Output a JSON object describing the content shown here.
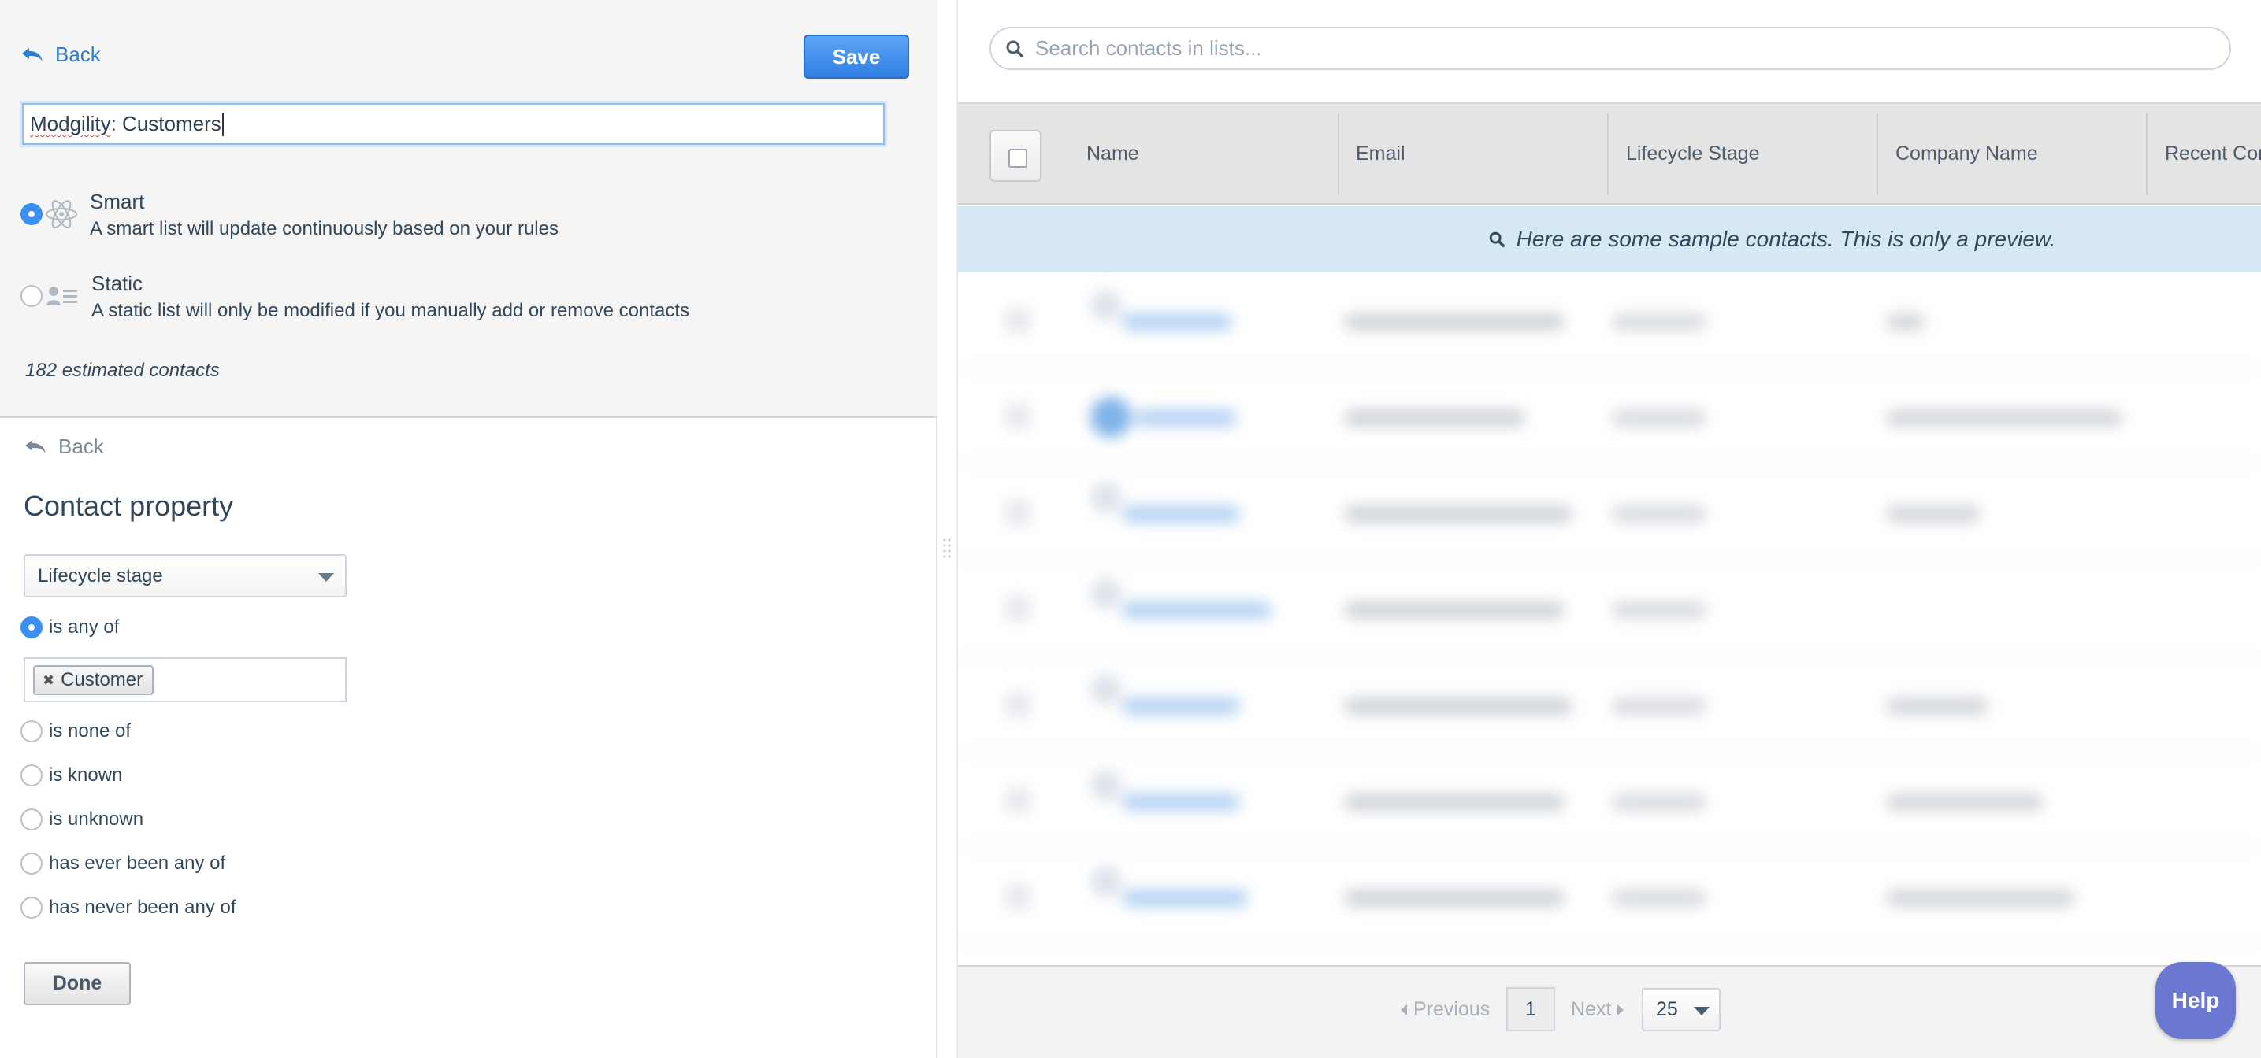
{
  "editor": {
    "back_label": "Back",
    "save_label": "Save",
    "list_name_prefix": "Modgility",
    "list_name_suffix": ": Customers",
    "list_types": [
      {
        "title": "Smart",
        "description": "A smart list will update continuously based on your rules",
        "selected": true,
        "icon": "atom-icon"
      },
      {
        "title": "Static",
        "description": "A static list will only be modified if you manually add or remove contacts",
        "selected": false,
        "icon": "contact-card-icon"
      }
    ],
    "estimate": "182 estimated contacts"
  },
  "filter": {
    "back_label": "Back",
    "title": "Contact property",
    "property_value": "Lifecycle stage",
    "operators": [
      {
        "label": "is any of",
        "selected": true
      },
      {
        "label": "is none of",
        "selected": false
      },
      {
        "label": "is known",
        "selected": false
      },
      {
        "label": "is unknown",
        "selected": false
      },
      {
        "label": "has ever been any of",
        "selected": false
      },
      {
        "label": "has never been any of",
        "selected": false
      }
    ],
    "tags": [
      {
        "label": "Customer",
        "remove_glyph": "✖"
      }
    ],
    "done_label": "Done"
  },
  "preview": {
    "search_placeholder": "Search contacts in lists...",
    "columns": [
      "Name",
      "Email",
      "Lifecycle Stage",
      "Company Name",
      "Recent Con"
    ],
    "notice": "Here are some sample contacts. This is only a preview.",
    "pagination": {
      "previous_label": "Previous",
      "next_label": "Next",
      "current_page": "1",
      "page_size": "25"
    }
  },
  "help_label": "Help",
  "colors": {
    "accent_blue": "#3a8ff0",
    "link_blue": "#2e7bd6",
    "notice_bg": "#d7e8f5",
    "help_purple": "#6a78d1"
  }
}
